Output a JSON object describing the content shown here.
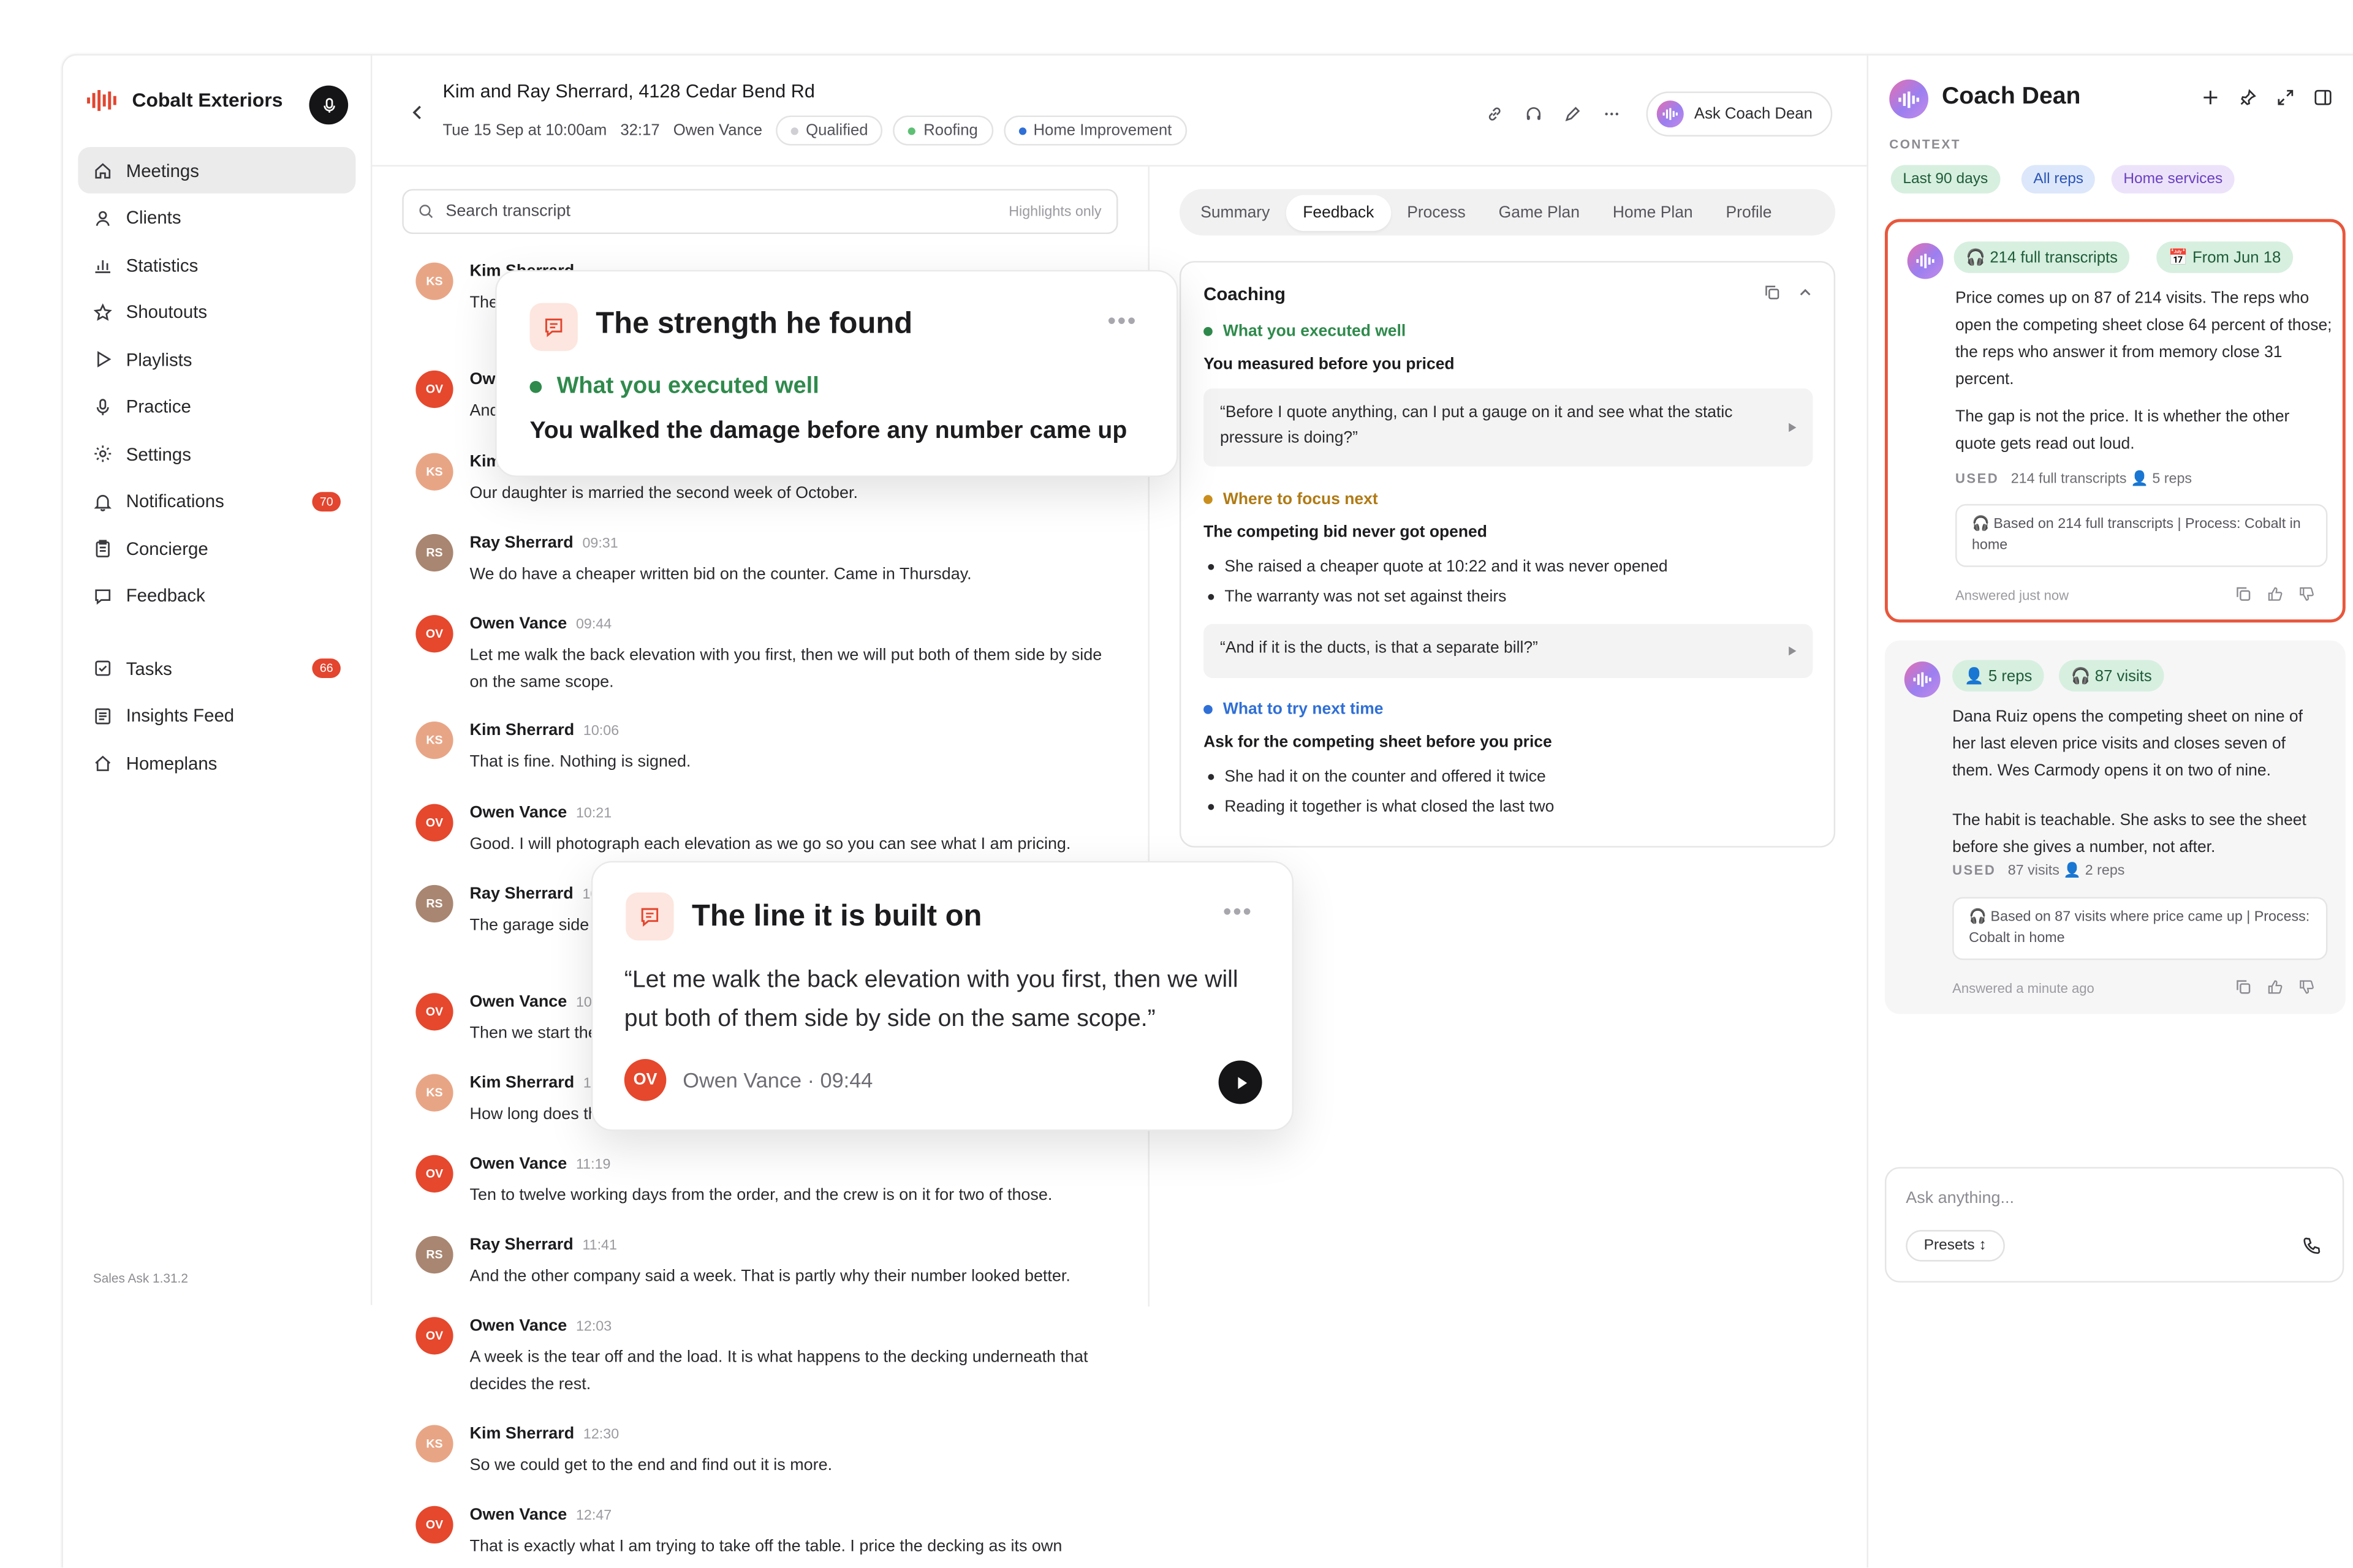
{
  "brand": {
    "name": "Cobalt Exteriors",
    "version": "Sales Ask 1.31.2"
  },
  "sidebar": {
    "items": [
      {
        "label": "Meetings",
        "icon": "home-icon",
        "active": true
      },
      {
        "label": "Clients",
        "icon": "person-icon"
      },
      {
        "label": "Statistics",
        "icon": "bar-chart-icon"
      },
      {
        "label": "Shoutouts",
        "icon": "star-icon"
      },
      {
        "label": "Playlists",
        "icon": "play-icon"
      },
      {
        "label": "Practice",
        "icon": "mic-icon"
      },
      {
        "label": "Settings",
        "icon": "gear-icon"
      },
      {
        "label": "Notifications",
        "icon": "bell-icon",
        "badge": "70"
      },
      {
        "label": "Concierge",
        "icon": "clipboard-icon"
      },
      {
        "label": "Feedback",
        "icon": "chat-icon"
      }
    ],
    "items2": [
      {
        "label": "Tasks",
        "icon": "checkbox-icon",
        "badge": "66"
      },
      {
        "label": "Insights Feed",
        "icon": "list-icon"
      },
      {
        "label": "Homeplans",
        "icon": "house-icon"
      }
    ]
  },
  "header": {
    "title": "Kim and Ray Sherrard, 4128 Cedar Bend Rd",
    "date": "Tue 15 Sep at 10:00am",
    "duration": "32:17",
    "rep": "Owen Vance",
    "pills": [
      {
        "label": "Qualified",
        "color": "#cfcfd4"
      },
      {
        "label": "Roofing",
        "color": "#5fbf74"
      },
      {
        "label": "Home Improvement",
        "color": "#2f6fd6"
      }
    ],
    "ask_button": "Ask Coach Dean"
  },
  "search": {
    "placeholder": "Search transcript",
    "highlights": "Highlights only"
  },
  "transcript": [
    {
      "initials": "KS",
      "speaker": "Kim Sherrard",
      "time": "",
      "text": "The gutters came down in the storm and the back wall has been leaking ever since."
    },
    {
      "initials": "OV",
      "speaker": "Owen Vance",
      "time": "",
      "text": "And has anyone been up to look at the decking yet?"
    },
    {
      "initials": "KS",
      "speaker": "Kim Sherrard",
      "time": "",
      "text": "Our daughter is married the second week of October."
    },
    {
      "initials": "RS",
      "speaker": "Ray Sherrard",
      "time": "09:31",
      "text": "We do have a cheaper written bid on the counter. Came in Thursday."
    },
    {
      "initials": "OV",
      "speaker": "Owen Vance",
      "time": "09:44",
      "text": "Let me walk the back elevation with you first, then we will put both of them side by side on the same scope."
    },
    {
      "initials": "KS",
      "speaker": "Kim Sherrard",
      "time": "10:06",
      "text": "That is fine. Nothing is signed."
    },
    {
      "initials": "OV",
      "speaker": "Owen Vance",
      "time": "10:21",
      "text": "Good. I will photograph each elevation as we go so you can see what I am pricing."
    },
    {
      "initials": "RS",
      "speaker": "Ray Sherrard",
      "time": "10:40",
      "text": "The garage side is the worst of it. There is soft wood underneath it."
    },
    {
      "initials": "OV",
      "speaker": "Owen Vance",
      "time": "10:52",
      "text": "Then we start there and work our way around."
    },
    {
      "initials": "KS",
      "speaker": "Kim Sherrard",
      "time": "11:05",
      "text": "How long does the whole job take once it starts?"
    },
    {
      "initials": "OV",
      "speaker": "Owen Vance",
      "time": "11:19",
      "text": "Ten to twelve working days from the order, and the crew is on it for two of those."
    },
    {
      "initials": "RS",
      "speaker": "Ray Sherrard",
      "time": "11:41",
      "text": "And the other company said a week. That is partly why their number looked better."
    },
    {
      "initials": "OV",
      "speaker": "Owen Vance",
      "time": "12:03",
      "text": "A week is the tear off and the load. It is what happens to the decking underneath that decides the rest."
    },
    {
      "initials": "KS",
      "speaker": "Kim Sherrard",
      "time": "12:30",
      "text": "So we could get to the end and find out it is more."
    },
    {
      "initials": "OV",
      "speaker": "Owen Vance",
      "time": "12:47",
      "text": "That is exactly what I am trying to take off the table. I price the decking as its own"
    }
  ],
  "tabs": [
    "Summary",
    "Feedback",
    "Process",
    "Game Plan",
    "Home Plan",
    "Profile"
  ],
  "coaching": {
    "title": "Coaching",
    "well_label": "What you executed well",
    "well_head": "You measured before you priced",
    "well_quote": "“Before I quote anything, can I put a gauge on it and see what the static pressure is doing?”",
    "focus_label": "Where to focus next",
    "focus_head": "The competing bid never got opened",
    "focus_bullets": [
      "She raised a cheaper quote at 10:22 and it was never opened",
      "The warranty was not set against theirs"
    ],
    "focus_quote": "“And if it is the ducts, is that a separate bill?”",
    "try_label": "What to try next time",
    "try_head": "Ask for the competing sheet before you price",
    "try_bullets": [
      "She had it on the counter and offered it twice",
      "Reading it together is what closed the last two"
    ]
  },
  "coach": {
    "title": "Coach Dean",
    "context_label": "CONTEXT",
    "chips": [
      "Last 90 days",
      "All reps",
      "Home services"
    ],
    "answers": [
      {
        "tags": [
          "🎧 214 full transcripts",
          "📅 From Jun 18"
        ],
        "p1": "Price comes up on 87 of 214 visits. The reps who open the competing sheet close 64 percent of those; the reps who answer it from memory close 31 percent.",
        "p2": "The gap is not the price. It is whether the other quote gets read out loud.",
        "used_label": "USED",
        "used": "214 full transcripts   👤 5 reps",
        "based": "🎧 Based on 214 full transcripts  |  Process: Cobalt in home",
        "time": "Answered just now"
      },
      {
        "tags": [
          "👤 5 reps",
          "🎧 87 visits"
        ],
        "p1": "Dana Ruiz opens the competing sheet on nine of her last eleven price visits and closes seven of them. Wes Carmody opens it on two of nine.",
        "p2": "The habit is teachable. She asks to see the sheet before she gives a number, not after.",
        "used_label": "USED",
        "used": "87 visits   👤 2 reps",
        "based": "🎧 Based on 87 visits where price came up  |  Process: Cobalt in home",
        "time": "Answered a minute ago"
      }
    ],
    "ask_placeholder": "Ask anything...",
    "presets": "Presets ↕"
  },
  "popup_strength": {
    "title": "The strength he found",
    "label": "What you executed well",
    "body": "You walked the damage before any number came up"
  },
  "popup_line": {
    "title": "The line it is built on",
    "quote": "“Let me walk the back elevation with you first, then we will put both of them side by side on the same scope.”",
    "initials": "OV",
    "attribution": "Owen Vance · 09:44"
  },
  "colors": {
    "accent_red": "#e3452f",
    "green": "#2f8a4c",
    "amber": "#b07a14",
    "blue": "#2f6fd6"
  }
}
